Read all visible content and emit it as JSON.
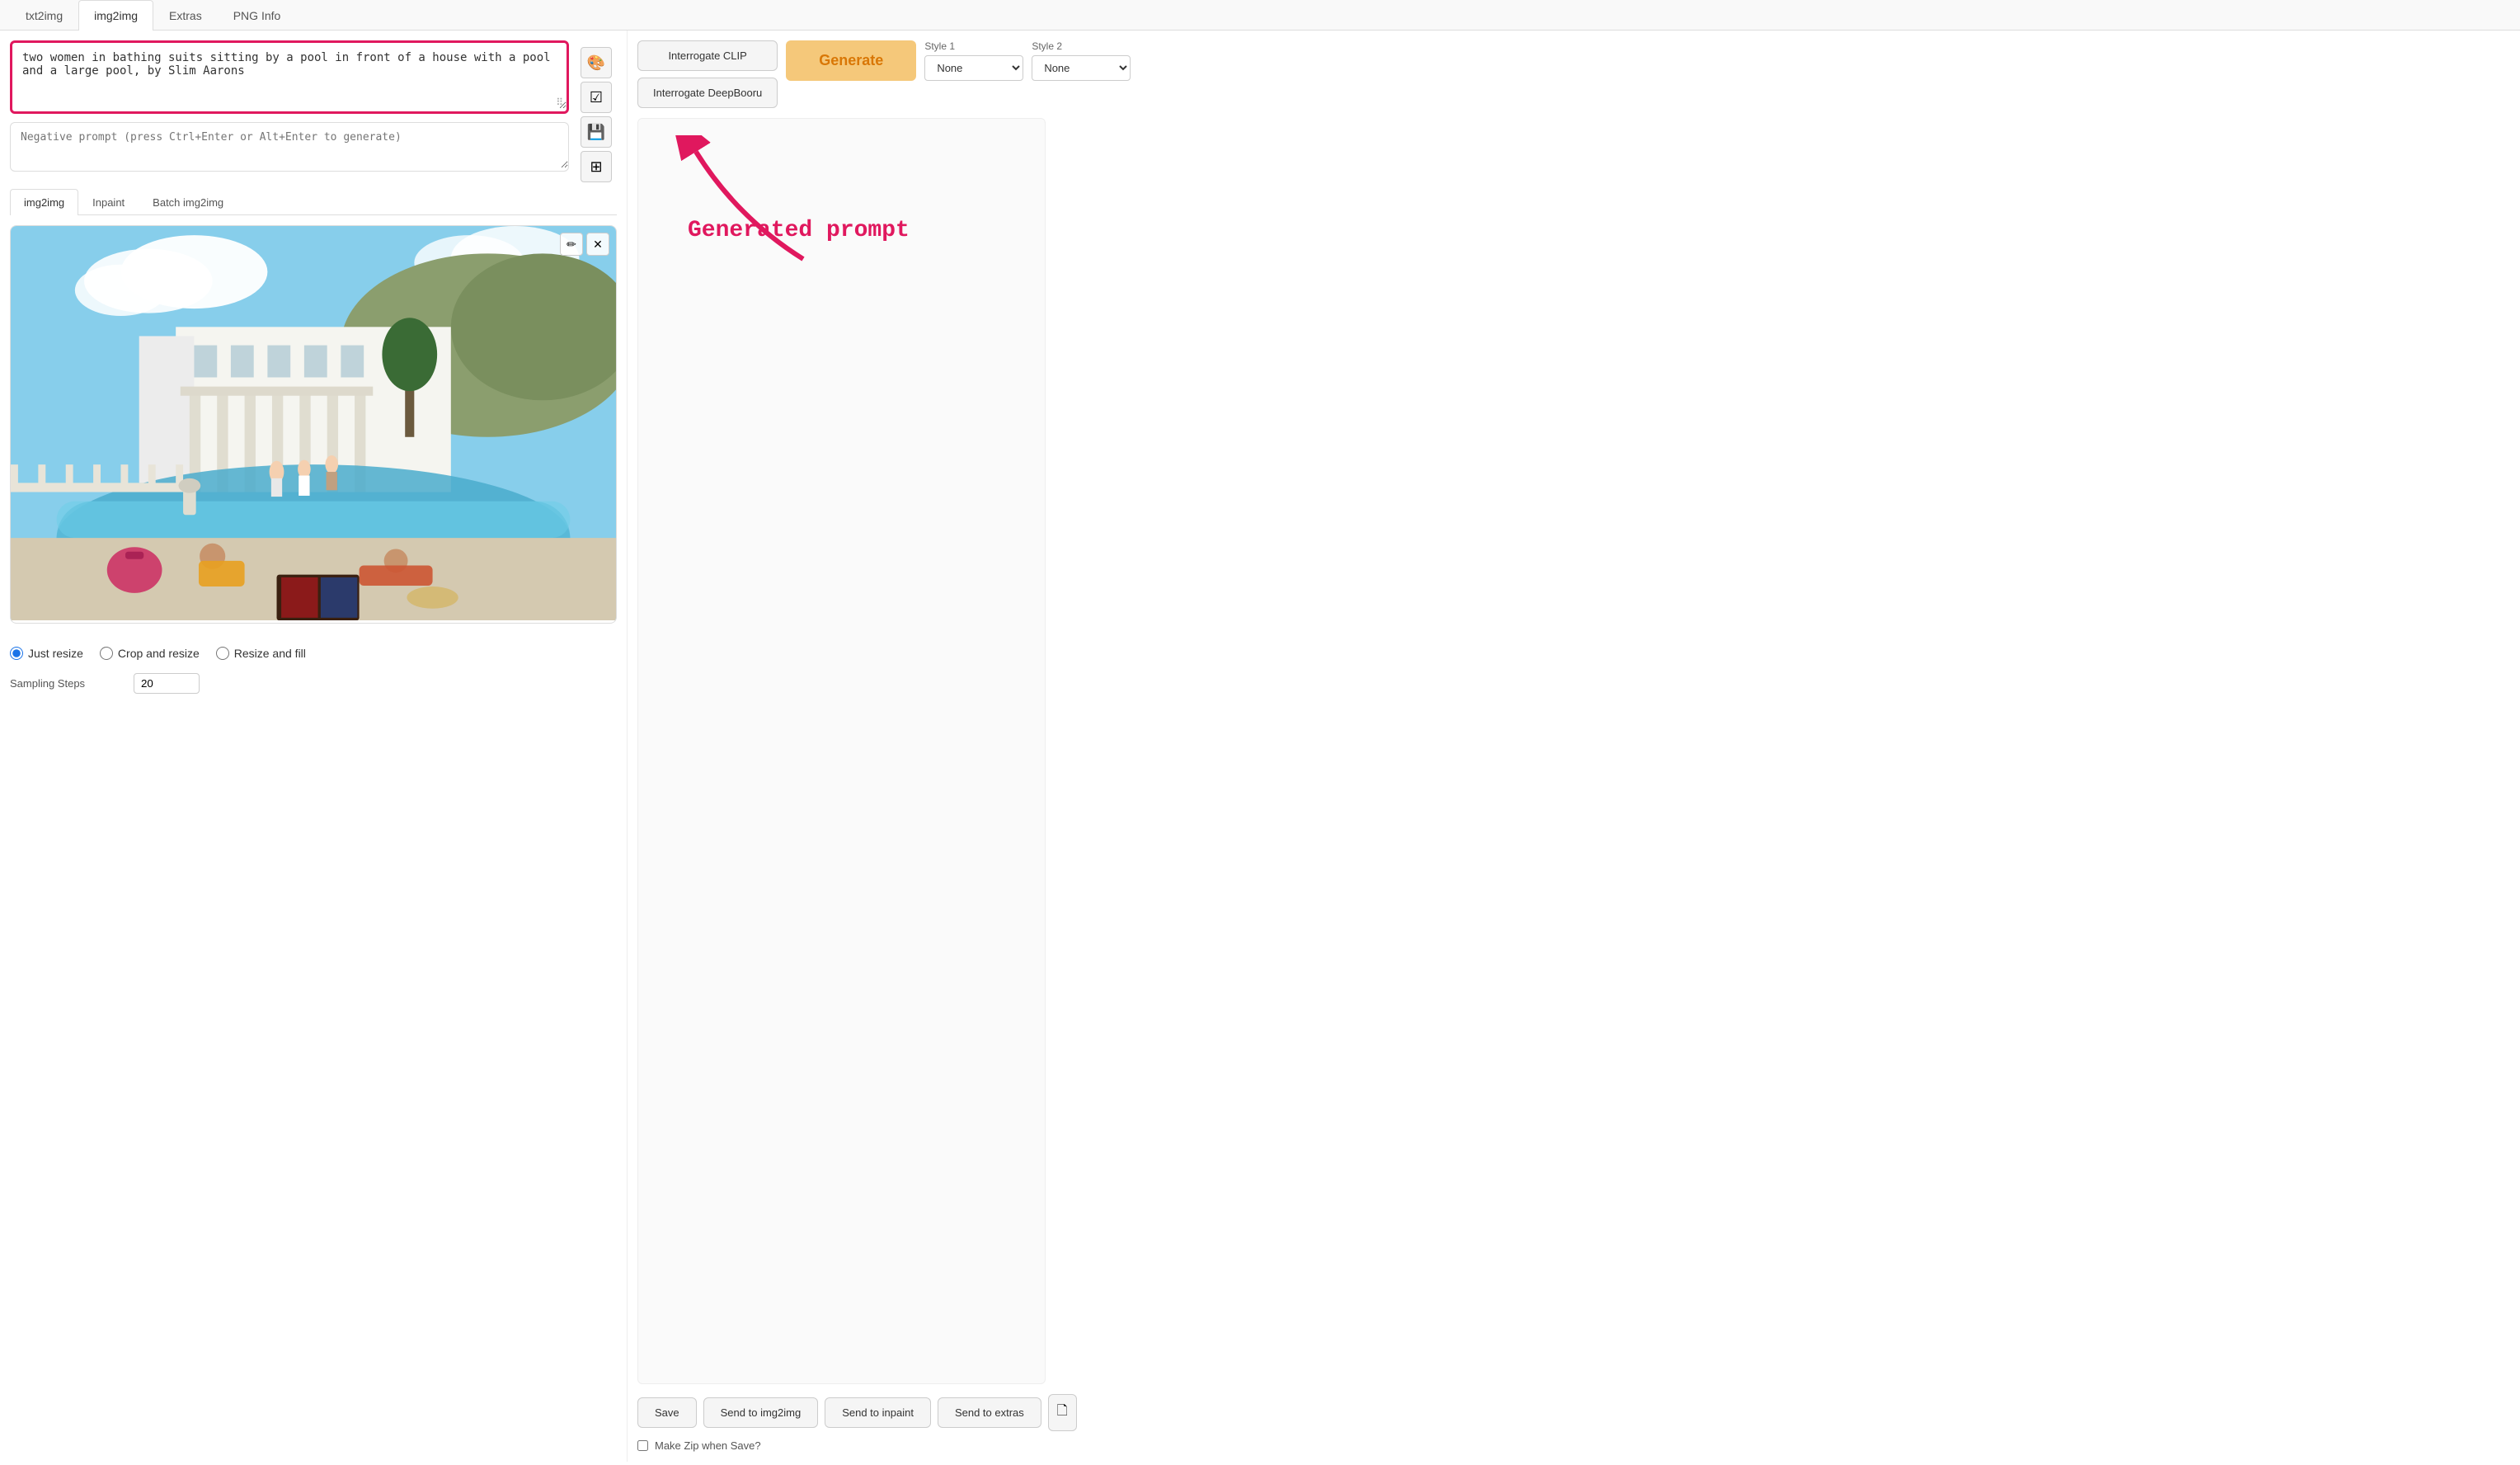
{
  "tabs": {
    "items": [
      {
        "label": "txt2img",
        "active": false
      },
      {
        "label": "img2img",
        "active": true
      },
      {
        "label": "Extras",
        "active": false
      },
      {
        "label": "PNG Info",
        "active": false
      }
    ]
  },
  "prompt": {
    "value": "two women in bathing suits sitting by a pool in front of a house with a pool and a large pool, by Slim Aarons",
    "negative_placeholder": "Negative prompt (press Ctrl+Enter or Alt+Enter to generate)"
  },
  "sub_tabs": {
    "items": [
      {
        "label": "img2img",
        "active": true
      },
      {
        "label": "Inpaint",
        "active": false
      },
      {
        "label": "Batch img2img",
        "active": false
      }
    ]
  },
  "resize_options": {
    "items": [
      {
        "label": "Just resize",
        "value": "just_resize",
        "selected": true
      },
      {
        "label": "Crop and resize",
        "value": "crop_resize",
        "selected": false
      },
      {
        "label": "Resize and fill",
        "value": "resize_fill",
        "selected": false
      }
    ]
  },
  "sampling": {
    "label": "Sampling Steps",
    "value": "20"
  },
  "buttons": {
    "interrogate_clip": "Interrogate CLIP",
    "interrogate_deepbooru": "Interrogate DeepBooru",
    "generate": "Generate",
    "save": "Save",
    "send_img2img": "Send to img2img",
    "send_inpaint": "Send to inpaint",
    "send_extras": "Send to extras"
  },
  "styles": {
    "style1": {
      "label": "Style 1",
      "options": [
        "None"
      ],
      "selected": "None"
    },
    "style2": {
      "label": "Style 2",
      "options": [
        "None"
      ],
      "selected": "None"
    }
  },
  "make_zip": {
    "label": "Make Zip when Save?",
    "checked": false
  },
  "annotation": {
    "text": "Generated prompt"
  },
  "icons": {
    "paint": "🎨",
    "check": "☑",
    "save": "💾",
    "grid": "⊞",
    "pencil": "✏",
    "close": "✕",
    "copy": "🗋"
  }
}
